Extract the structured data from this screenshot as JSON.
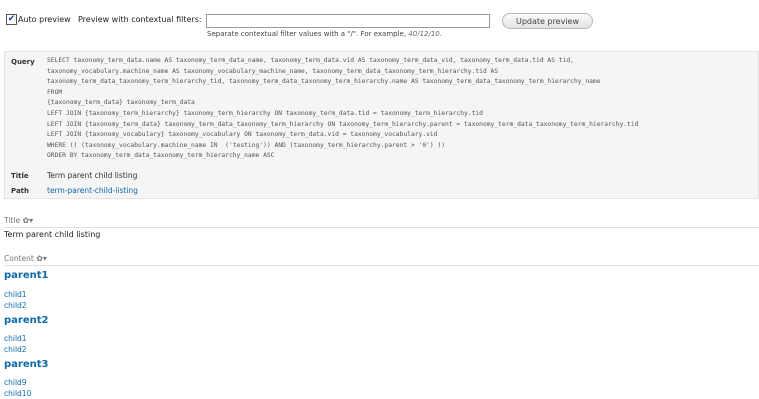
{
  "controls": {
    "auto_preview_label": "Auto preview",
    "contextual_label": "Preview with contextual filters:",
    "filter_value": "",
    "hint_prefix": "Separate contextual filter values with a \"/\". For example, ",
    "hint_example": "40/12/10.",
    "update_button": "Update preview"
  },
  "info": {
    "query_key": "Query",
    "sql_lines": [
      "SELECT taxonomy_term_data.name AS taxonomy_term_data_name, taxonomy_term_data.vid AS taxonomy_term_data_vid, taxonomy_term_data.tid AS tid,",
      "taxonomy_vocabulary.machine_name AS taxonomy_vocabulary_machine_name, taxonomy_term_data_taxonomy_term_hierarchy.tid AS",
      "taxonomy_term_data_taxonomy_term_hierarchy_tid, taxonomy_term_data_taxonomy_term_hierarchy.name AS taxonomy_term_data_taxonomy_term_hierarchy_name",
      "FROM",
      "{taxonomy_term_data} taxonomy_term_data",
      "LEFT JOIN {taxonomy_term_hierarchy} taxonomy_term_hierarchy ON taxonomy_term_data.tid = taxonomy_term_hierarchy.tid",
      "LEFT JOIN {taxonomy_term_data} taxonomy_term_data_taxonomy_term_hierarchy ON taxonomy_term_hierarchy.parent = taxonomy_term_data_taxonomy_term_hierarchy.tid",
      "LEFT JOIN {taxonomy_vocabulary} taxonomy_vocabulary ON taxonomy_term_data.vid = taxonomy_vocabulary.vid",
      "WHERE (( (taxonomy_vocabulary.machine_name IN  ('testing')) AND (taxonomy_term_hierarchy.parent > '0') ))",
      "ORDER BY taxonomy_term_data_taxonomy_term_hierarchy_name ASC"
    ],
    "title_key": "Title",
    "title_value": "Term parent child listing",
    "path_key": "Path",
    "path_value": "term-parent-child-listing"
  },
  "preview": {
    "title_label": "Title",
    "gear_glyph": "✿▾",
    "title_text": "Term parent child listing",
    "content_label": "Content",
    "groups": [
      {
        "parent": "parent1",
        "children": [
          "child1",
          "child2"
        ]
      },
      {
        "parent": "parent2",
        "children": [
          "child1",
          "child2"
        ]
      },
      {
        "parent": "parent3",
        "children": [
          "child9",
          "child10"
        ]
      }
    ]
  }
}
